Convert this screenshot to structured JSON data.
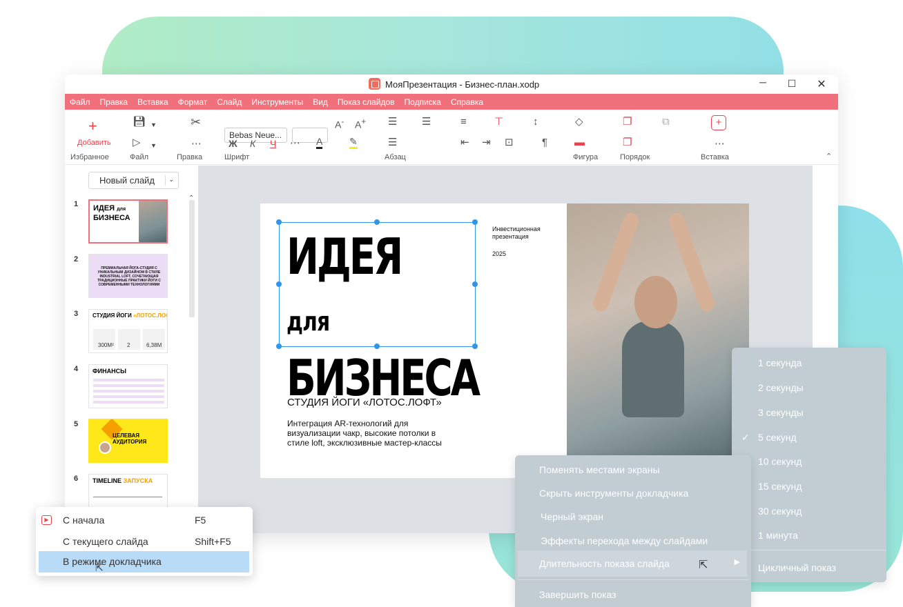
{
  "window": {
    "title": "МояПрезентация - Бизнес-план.xodp"
  },
  "menu": [
    "Файл",
    "Правка",
    "Вставка",
    "Формат",
    "Слайд",
    "Инструменты",
    "Вид",
    "Показ слайдов",
    "Подписка",
    "Справка"
  ],
  "toolbar": {
    "add_label": "Добавить",
    "groups": {
      "fav": "Избранное",
      "file": "Файл",
      "edit": "Правка",
      "font": "Шрифт",
      "para": "Абзац",
      "shape": "Фигура",
      "order": "Порядок",
      "insert": "Вставка"
    },
    "font_name": "Bebas Neue...",
    "bold": "Ж",
    "italic": "К",
    "underline": "Ч"
  },
  "panel": {
    "new_slide": "Новый слайд",
    "numbers": [
      "1",
      "2",
      "3",
      "4",
      "5",
      "6"
    ],
    "t1": {
      "title_a": "ИДЕЯ",
      "title_b": "для",
      "title_c": "БИЗНЕСА"
    },
    "t2": {
      "text": "ПРЕМИАЛЬНАЯ ЙОГА-СТУДИЯ С УНИКАЛЬНЫМ ДИЗАЙНОМ В СТИЛЕ INDUSTRIAL LOFT, СОЧЕТАЮЩАЯ ТРАДИЦИОННЫЕ ПРАКТИКИ ЙОГИ С СОВРЕМЕННЫМИ ТЕХНОЛОГИЯМИ"
    },
    "t3": {
      "title": "СТУДИЯ ЙОГИ",
      "accent": "«ЛОТОС.ЛОФТ»",
      "v1": "300М²",
      "v2": "2",
      "v3": "6,38М"
    },
    "t4": {
      "title": "ФИНАНСЫ"
    },
    "t5": {
      "title": "ЦЕЛЕВАЯ АУДИТОРИЯ"
    },
    "t6": {
      "title": "TIMELINE",
      "accent": "ЗАПУСКА"
    }
  },
  "slide": {
    "title_line1": "ИДЕЯ",
    "title_small": "для",
    "title_line2": "БИЗНЕСА",
    "subtitle_top": "Инвестиционная презентация",
    "year": "2025",
    "studio": "СТУДИЯ ЙОГИ «ЛОТОС.ЛОФТ»",
    "description": "Интеграция AR-технологий для визуализации чакр, высокие потолки в стиле loft, эксклюзивные мастер-классы"
  },
  "start_menu": [
    {
      "label": "С начала",
      "shortcut": "F5"
    },
    {
      "label": "С текущего слайда",
      "shortcut": "Shift+F5"
    },
    {
      "label": "В режиме докладчика",
      "shortcut": ""
    }
  ],
  "presenter_menu": {
    "items": [
      "Поменять местами экраны",
      "Скрыть инструменты докладчика",
      "Черный экран",
      "Эффекты перехода между слайдами",
      "Длительность показа слайда",
      "Завершить показ"
    ]
  },
  "duration_menu": {
    "items": [
      "1 секунда",
      "2 секунды",
      "3 секунды",
      "5 секунд",
      "10 секунд",
      "15 секунд",
      "30 секунд",
      "1 минута"
    ],
    "selected": "5 секунд",
    "loop": "Цикличный показ"
  },
  "colors": {
    "accent": "#f0717b",
    "selection": "#2f96ea",
    "menu_bg": "#c1ccd3",
    "yellow": "#ffe81a"
  }
}
